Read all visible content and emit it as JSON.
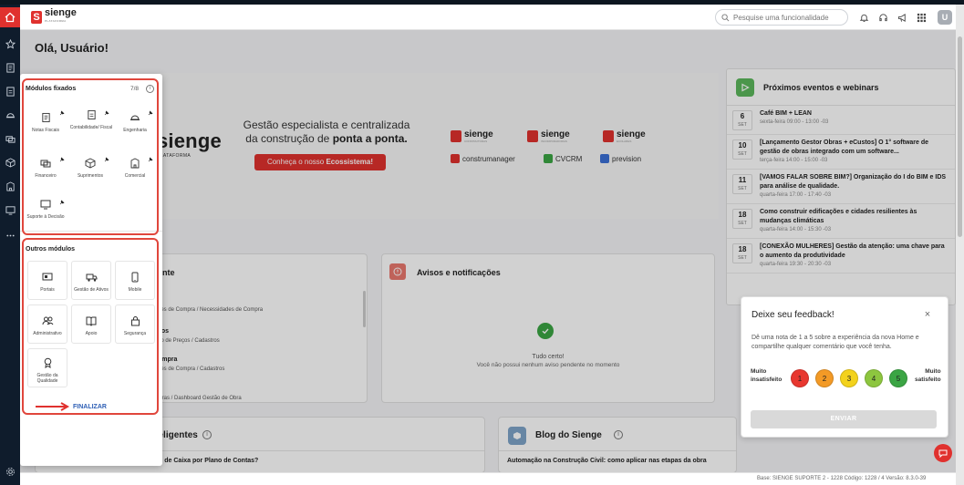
{
  "header": {
    "logo_text": "sienge",
    "logo_sub": "PLATAFORMA",
    "search_placeholder": "Pesquise uma funcionalidade",
    "avatar_letter": "U"
  },
  "greeting": "Olá, Usuário!",
  "banner": {
    "logo": "sienge",
    "logo_sub": "PLATAFORMA",
    "tagline_1": "Gestão especialista e centralizada",
    "tagline_2": "da construção de ",
    "tagline_bold": "ponta a ponta.",
    "cta_prefix": "Conheça o nosso ",
    "cta_bold": "Ecossistema!",
    "brands": [
      "sienge",
      "sienge",
      "sienge"
    ],
    "brand_subs": [
      "CONSTRUTORAS",
      "INCORPORADORAS",
      "ECOLARES"
    ],
    "partners": [
      "construmanager",
      "CVCRM",
      "prevision"
    ]
  },
  "events": {
    "title": "Próximos eventos e webinars",
    "items": [
      {
        "day": "6",
        "month": "SET",
        "title": "Café BIM + LEAN",
        "sub": "sexta-feira 09:00 - 13:00 -03"
      },
      {
        "day": "10",
        "month": "SET",
        "title": "[Lançamento Gestor Obras + eCustos] O 1° software de gestão de obras integrado com um software...",
        "sub": "terça-feira 14:00 - 15:00 -03"
      },
      {
        "day": "11",
        "month": "SET",
        "title": "[VAMOS FALAR SOBRE BIM?] Organização do I do BIM e IDS para análise de qualidade.",
        "sub": "quarta-feira 17:00 - 17:40 -03"
      },
      {
        "day": "18",
        "month": "SET",
        "title": "Como construir edificações e cidades resilientes às mudanças climáticas",
        "sub": "quarta-feira 14:00 - 15:30 -03"
      },
      {
        "day": "18",
        "month": "SET",
        "title": "[CONEXÃO MULHERES] Gestão da atenção: uma chave para o aumento da produtividade",
        "sub": "quarta-feira 19:30 - 20:30 -03"
      }
    ]
  },
  "recent": {
    "title_fragment": "ente",
    "lines": [
      {
        "bold": "",
        "text": "ões de Compra / Necessidades de Compra"
      },
      {
        "bold": "ços",
        "text": "ão de Preços / Cadastros"
      },
      {
        "bold": "ompra",
        "text": "ões de Compra / Cadastros"
      },
      {
        "bold": "",
        "text": "ibras / Dashboard Gestão de Obra"
      }
    ]
  },
  "notices": {
    "title": "Avisos e notificações",
    "empty_title": "Tudo certo!",
    "empty_sub": "Você não possui nenhum aviso pendente no momento"
  },
  "feedback": {
    "title": "Deixe seu feedback!",
    "close": "×",
    "text": "Dê uma nota de 1 a 5 sobre a experiência da nova Home e compartilhe qualquer comentário que você tenha.",
    "low_1": "Muito",
    "low_2": "insatisfeito",
    "high_1": "Muito",
    "high_2": "satisfeito",
    "ratings": [
      "1",
      "2",
      "3",
      "4",
      "5"
    ],
    "rating_colors": [
      "#e8372f",
      "#f39a26",
      "#f3d21b",
      "#8dc63f",
      "#3ba544"
    ],
    "send": "ENVIAR"
  },
  "recommendations": {
    "title": "Recomendações inteligentes",
    "item": "Como gerar e analisar o relatório Fluxo de Caixa por Plano de Contas?"
  },
  "blog": {
    "title": "Blog do Sienge",
    "item": "Automação na Construção Civil: como aplicar nas etapas da obra"
  },
  "modules_panel": {
    "fixed_title": "Módulos fixados",
    "fixed_count": "7/8",
    "fixed": [
      {
        "label": "Notas Fiscais",
        "icon": "invoice-icon"
      },
      {
        "label": "Contabilidade/ Fiscal",
        "icon": "accounting-icon"
      },
      {
        "label": "Engenharia",
        "icon": "helmet-icon"
      },
      {
        "label": "Financeiro",
        "icon": "finance-icon"
      },
      {
        "label": "Suprimentos",
        "icon": "box-icon"
      },
      {
        "label": "Comercial",
        "icon": "building-icon"
      },
      {
        "label": "Suporte à Decisão",
        "icon": "monitor-chart-icon"
      }
    ],
    "other_title": "Outros módulos",
    "others": [
      {
        "label": "Portais",
        "icon": "portal-icon"
      },
      {
        "label": "Gestão de Ativos",
        "icon": "truck-icon"
      },
      {
        "label": "Mobile",
        "icon": "mobile-icon"
      },
      {
        "label": "Administrativo",
        "icon": "people-icon"
      },
      {
        "label": "Apoio",
        "icon": "book-icon"
      },
      {
        "label": "Segurança",
        "icon": "lock-icon"
      },
      {
        "label": "Gestão da Qualidade",
        "icon": "badge-icon"
      }
    ],
    "finish": "FINALIZAR"
  },
  "footer": {
    "info": "Base: SIENGE SUPORTE 2 - 1228   Código: 1228 / 4   Versão: 8.3.0-39"
  },
  "colors": {
    "brand_red": "#e0312e",
    "sidebar": "#0f1c2c",
    "highlight": "#e0463c"
  }
}
